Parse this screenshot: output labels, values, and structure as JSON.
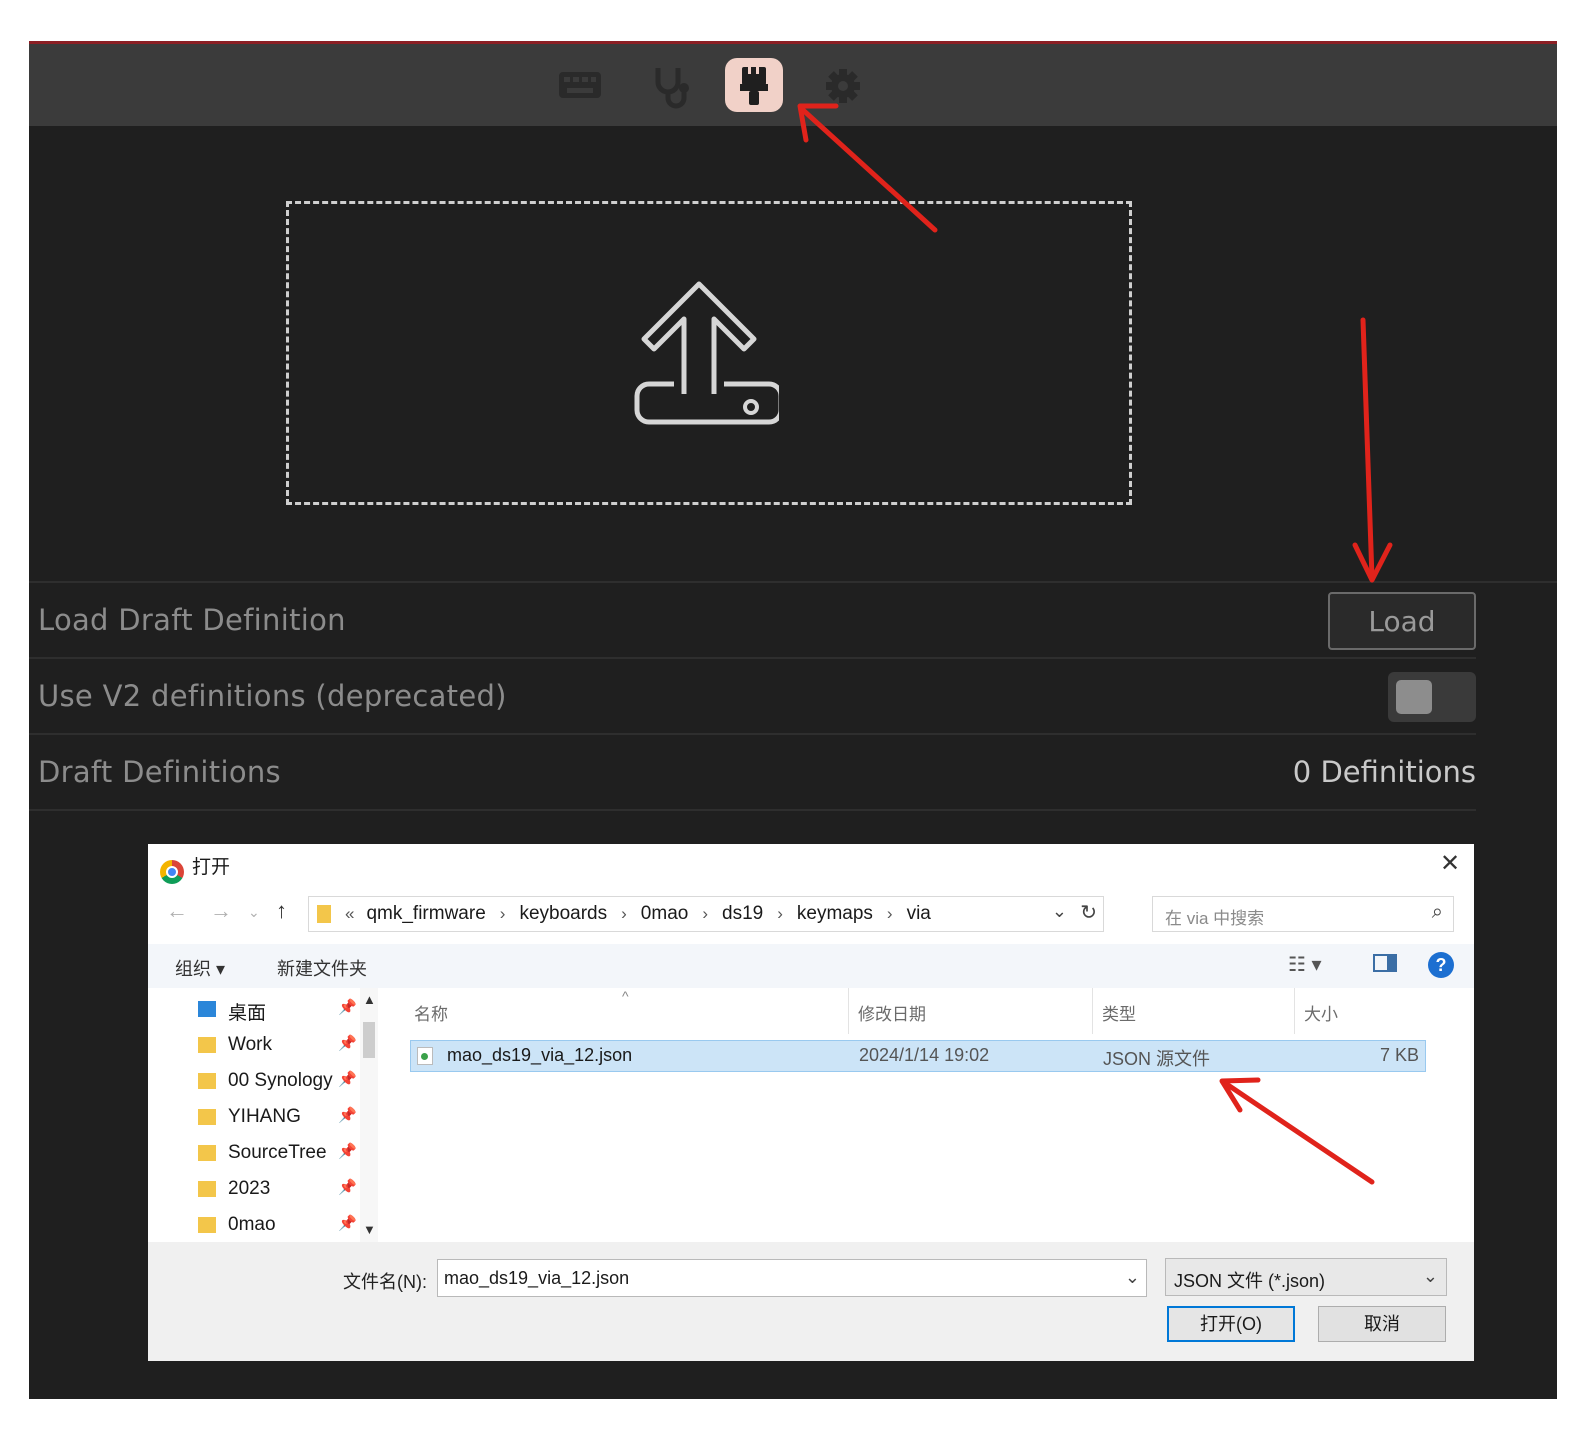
{
  "app": {
    "tabs": [
      {
        "icon": "keyboard-icon",
        "active": false
      },
      {
        "icon": "stethoscope-icon",
        "active": false
      },
      {
        "icon": "paintbrush-icon",
        "active": true
      },
      {
        "icon": "gear-icon",
        "active": false
      }
    ],
    "dropzone_icon": "upload-icon",
    "rows": {
      "load_draft_label": "Load Draft Definition",
      "load_button": "Load",
      "use_v2_label": "Use V2 definitions (deprecated)",
      "use_v2_enabled": false,
      "draft_defs_label": "Draft Definitions",
      "draft_defs_count": "0 Definitions"
    },
    "colors": {
      "accent_tab": "#f1d1c8",
      "background": "#1f1f1f",
      "topbar": "#3b3b3b",
      "arrow": "#e0231b"
    }
  },
  "dialog": {
    "title": "打开",
    "close": "✕",
    "nav": {
      "back": "←",
      "forward": "→",
      "up": "↑"
    },
    "breadcrumbs": [
      "qmk_firmware",
      "keyboards",
      "0mao",
      "ds19",
      "keymaps",
      "via"
    ],
    "breadcrumb_lead": "«",
    "search_placeholder": "在 via 中搜索",
    "toolbar": {
      "organize": "组织 ▾",
      "new_folder": "新建文件夹"
    },
    "sidebar": [
      {
        "label": "桌面",
        "icon": "desktop-icon"
      },
      {
        "label": "Work",
        "icon": "folder-icon"
      },
      {
        "label": "00 Synology",
        "icon": "folder-icon"
      },
      {
        "label": "YIHANG",
        "icon": "folder-icon"
      },
      {
        "label": "SourceTree",
        "icon": "folder-icon"
      },
      {
        "label": "2023",
        "icon": "folder-icon"
      },
      {
        "label": "0mao",
        "icon": "folder-icon"
      }
    ],
    "columns": {
      "name": "名称",
      "modified": "修改日期",
      "type": "类型",
      "size": "大小"
    },
    "files": [
      {
        "name": "mao_ds19_via_12.json",
        "modified": "2024/1/14 19:02",
        "type": "JSON 源文件",
        "size": "7 KB"
      }
    ],
    "filename_label": "文件名(N):",
    "filename_value": "mao_ds19_via_12.json",
    "filetype_value": "JSON 文件 (*.json)",
    "open_button": "打开(O)",
    "cancel_button": "取消"
  }
}
